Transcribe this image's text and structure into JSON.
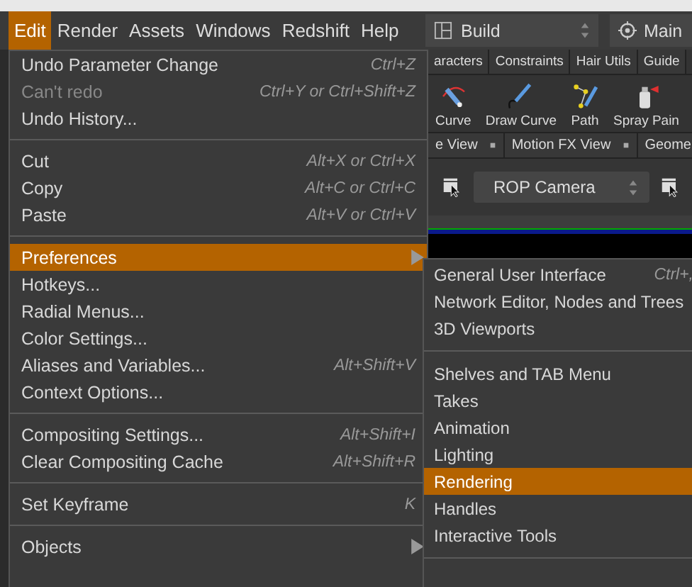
{
  "menubar": {
    "items": [
      {
        "label": "Edit",
        "selected": true
      },
      {
        "label": "Render",
        "selected": false
      },
      {
        "label": "Assets",
        "selected": false
      },
      {
        "label": "Windows",
        "selected": false
      },
      {
        "label": "Redshift",
        "selected": false
      },
      {
        "label": "Help",
        "selected": false
      }
    ],
    "desktop": "Build",
    "viewport_layout": "Main"
  },
  "shelf_tabs": [
    "aracters",
    "Constraints",
    "Hair Utils",
    "Guide"
  ],
  "shelf_tools": [
    {
      "label": "Curve"
    },
    {
      "label": "Draw Curve"
    },
    {
      "label": "Path"
    },
    {
      "label": "Spray Pain"
    }
  ],
  "pane_tabs": [
    {
      "label": "e View",
      "closable": true
    },
    {
      "label": "Motion FX View",
      "closable": true
    },
    {
      "label": "Geome",
      "closable": false
    }
  ],
  "camera_dropdown": "ROP Camera",
  "edit_menu": [
    {
      "kind": "item",
      "label": "Undo Parameter Change",
      "shortcut": "Ctrl+Z",
      "disabled": false,
      "selected": false,
      "submenu": false
    },
    {
      "kind": "item",
      "label": "Can't redo",
      "shortcut": "Ctrl+Y or Ctrl+Shift+Z",
      "disabled": true,
      "selected": false,
      "submenu": false
    },
    {
      "kind": "item",
      "label": "Undo History...",
      "disabled": false,
      "selected": false,
      "submenu": false
    },
    {
      "kind": "separator"
    },
    {
      "kind": "item",
      "label": "Cut",
      "shortcut": "Alt+X or Ctrl+X",
      "disabled": false,
      "selected": false,
      "submenu": false
    },
    {
      "kind": "item",
      "label": "Copy",
      "shortcut": "Alt+C or Ctrl+C",
      "disabled": false,
      "selected": false,
      "submenu": false
    },
    {
      "kind": "item",
      "label": "Paste",
      "shortcut": "Alt+V or Ctrl+V",
      "disabled": false,
      "selected": false,
      "submenu": false
    },
    {
      "kind": "separator"
    },
    {
      "kind": "item",
      "label": "Preferences",
      "disabled": false,
      "selected": true,
      "submenu": true
    },
    {
      "kind": "item",
      "label": "Hotkeys...",
      "disabled": false,
      "selected": false,
      "submenu": false
    },
    {
      "kind": "item",
      "label": "Radial Menus...",
      "disabled": false,
      "selected": false,
      "submenu": false
    },
    {
      "kind": "item",
      "label": "Color Settings...",
      "disabled": false,
      "selected": false,
      "submenu": false
    },
    {
      "kind": "item",
      "label": "Aliases and Variables...",
      "shortcut": "Alt+Shift+V",
      "disabled": false,
      "selected": false,
      "submenu": false
    },
    {
      "kind": "item",
      "label": "Context Options...",
      "disabled": false,
      "selected": false,
      "submenu": false
    },
    {
      "kind": "separator"
    },
    {
      "kind": "item",
      "label": "Compositing Settings...",
      "shortcut": "Alt+Shift+I",
      "disabled": false,
      "selected": false,
      "submenu": false
    },
    {
      "kind": "item",
      "label": "Clear Compositing Cache",
      "shortcut": "Alt+Shift+R",
      "disabled": false,
      "selected": false,
      "submenu": false
    },
    {
      "kind": "separator"
    },
    {
      "kind": "item",
      "label": "Set Keyframe",
      "shortcut": "K",
      "disabled": false,
      "selected": false,
      "submenu": false
    },
    {
      "kind": "separator"
    },
    {
      "kind": "item",
      "label": "Objects",
      "disabled": false,
      "selected": false,
      "submenu": true
    }
  ],
  "preferences_submenu": [
    {
      "kind": "item",
      "label": "General User Interface",
      "shortcut": "Ctrl+,",
      "selected": false
    },
    {
      "kind": "item",
      "label": "Network Editor, Nodes and Trees",
      "selected": false
    },
    {
      "kind": "item",
      "label": "3D Viewports",
      "selected": false
    },
    {
      "kind": "separator"
    },
    {
      "kind": "item",
      "label": "Shelves and TAB Menu",
      "selected": false
    },
    {
      "kind": "item",
      "label": "Takes",
      "selected": false
    },
    {
      "kind": "item",
      "label": "Animation",
      "selected": false
    },
    {
      "kind": "item",
      "label": "Lighting",
      "selected": false
    },
    {
      "kind": "item",
      "label": "Rendering",
      "selected": true
    },
    {
      "kind": "item",
      "label": "Handles",
      "selected": false
    },
    {
      "kind": "item",
      "label": "Interactive Tools",
      "selected": false
    },
    {
      "kind": "separator"
    }
  ]
}
